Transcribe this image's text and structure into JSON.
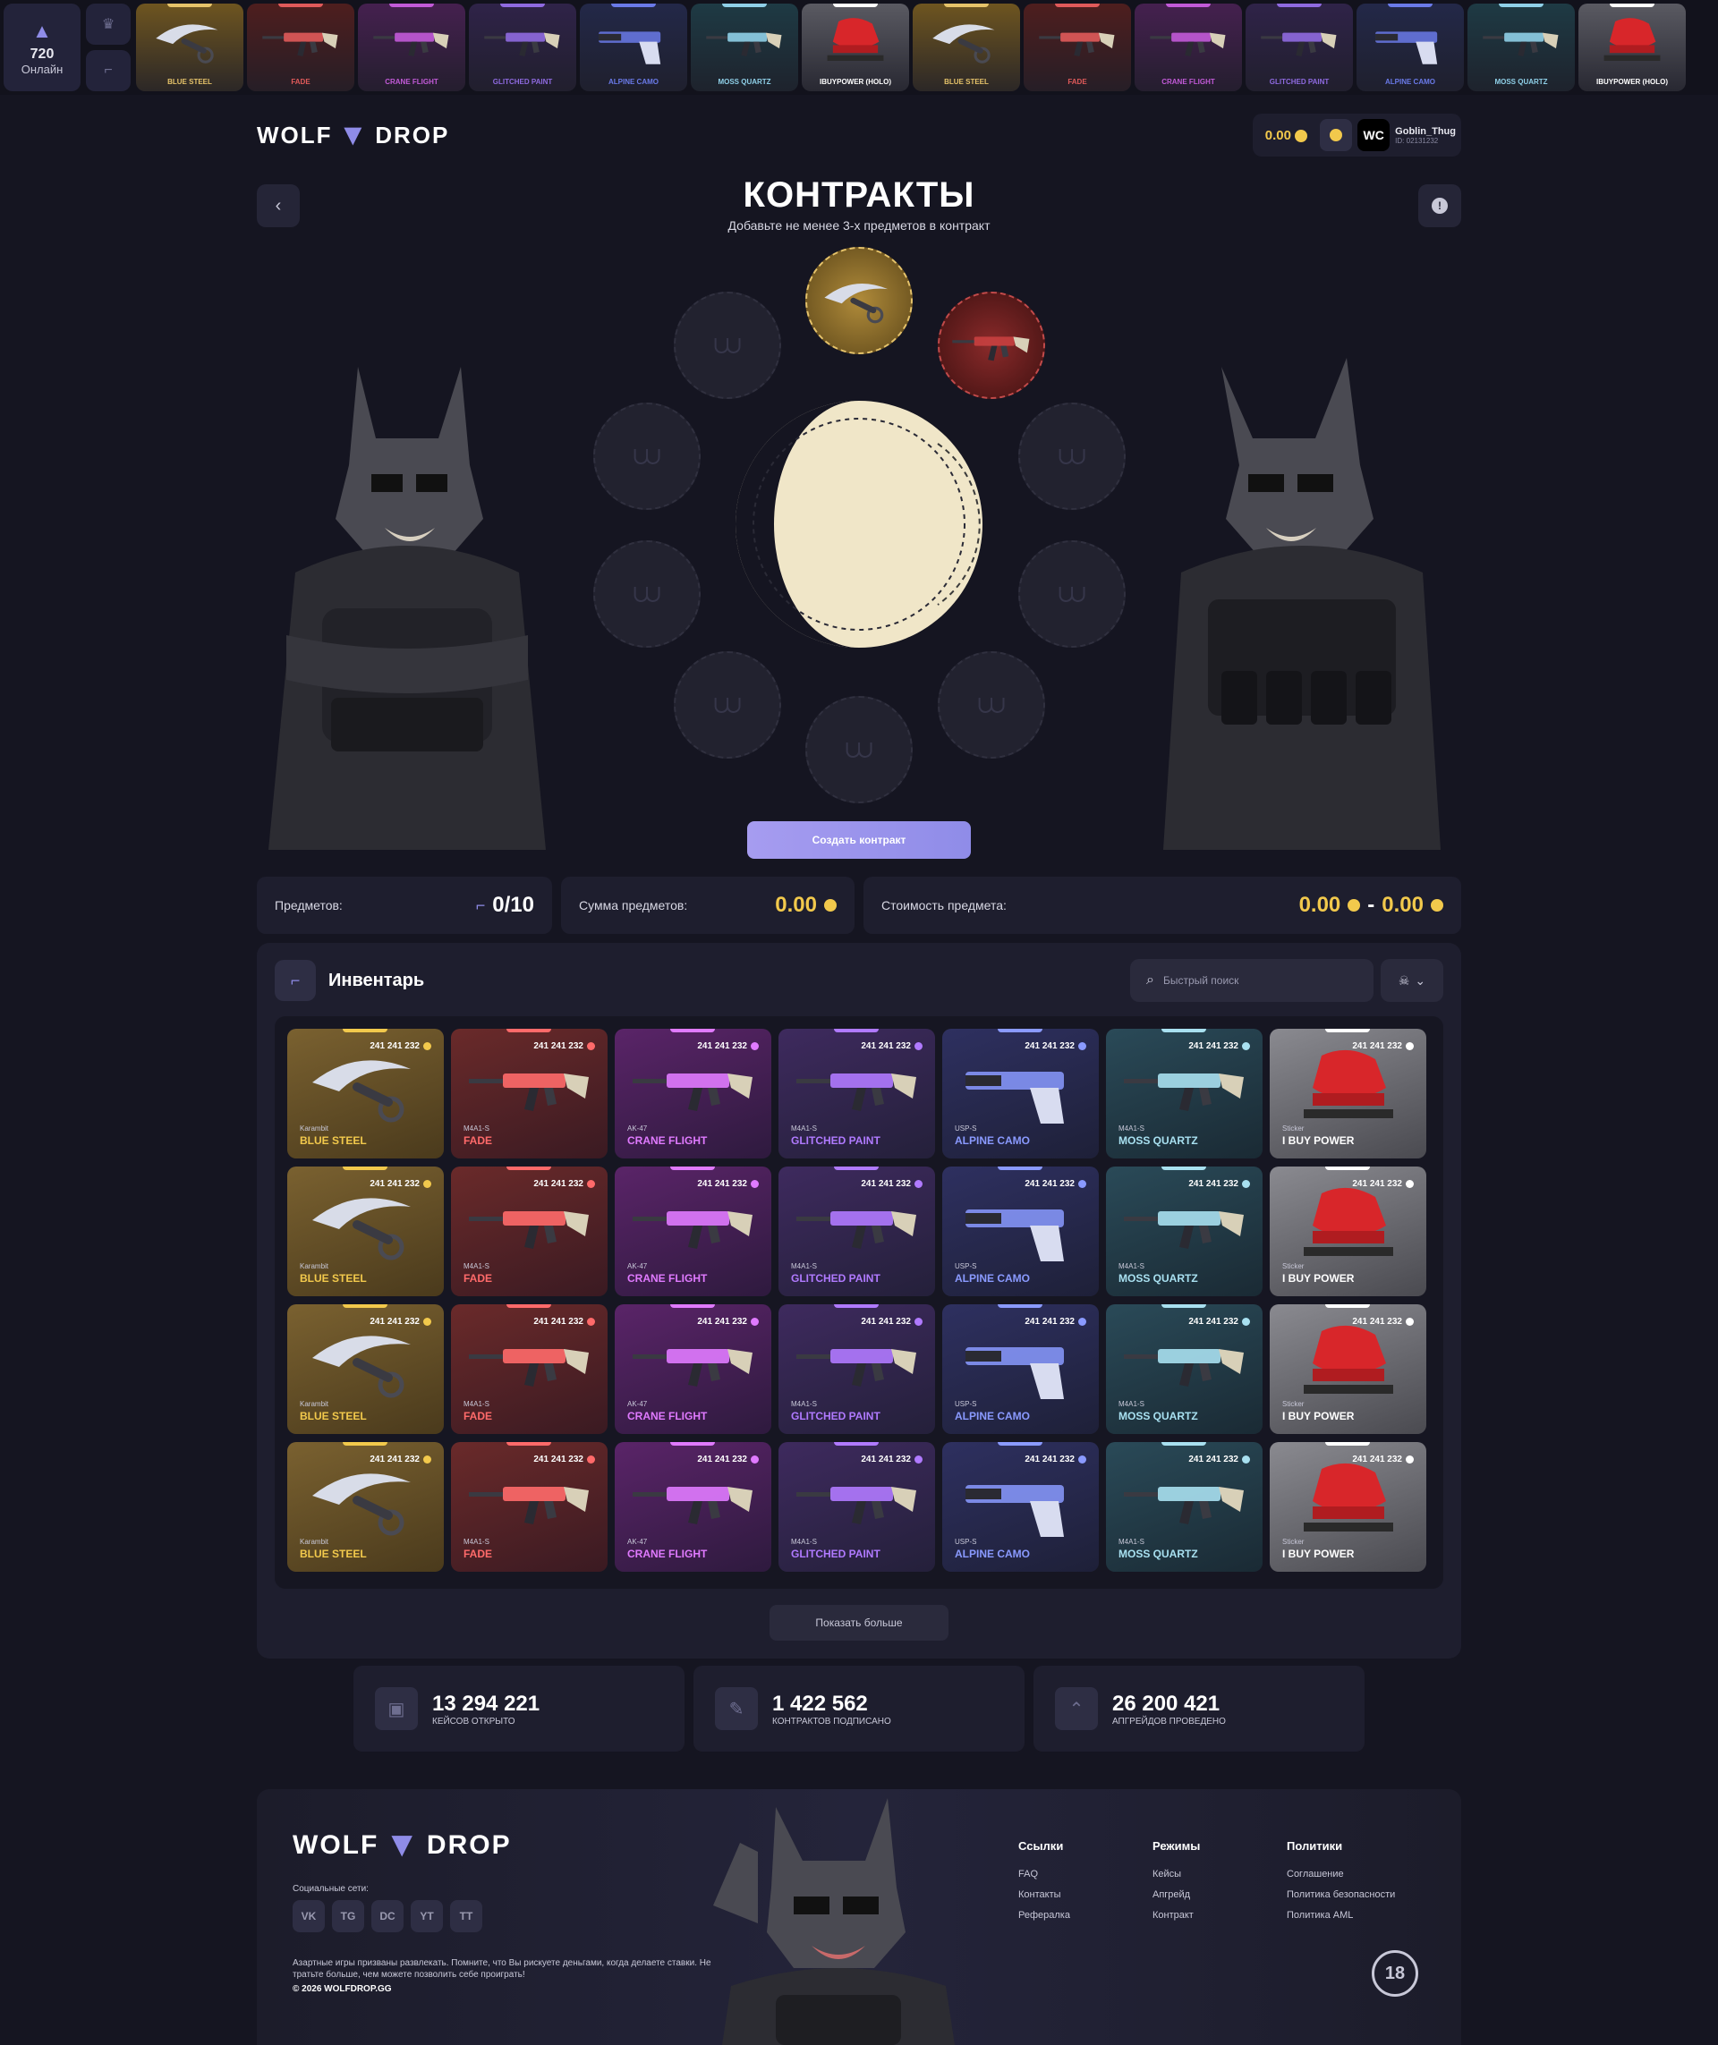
{
  "online": {
    "count": "720",
    "label": "Онлайн"
  },
  "live_drops": [
    {
      "name": "BLUE STEEL",
      "color": "#e6c36a",
      "bg": "#6e5520",
      "kind": "knife"
    },
    {
      "name": "FADE",
      "color": "#e05a5a",
      "bg": "#4e1e1e",
      "kind": "rifle"
    },
    {
      "name": "CRANE FLIGHT",
      "color": "#c25ad8",
      "bg": "#45204f",
      "kind": "rifle"
    },
    {
      "name": "GLITCHED PAINT",
      "color": "#8f6ae0",
      "bg": "#2f2348",
      "kind": "rifle"
    },
    {
      "name": "ALPINE CAMO",
      "color": "#6a7ae8",
      "bg": "#232848",
      "kind": "pistol"
    },
    {
      "name": "MOSS QUARTZ",
      "color": "#8fd0e8",
      "bg": "#1e3a44",
      "kind": "rifle"
    },
    {
      "name": "iBUYPOWER (Holo)",
      "color": "#ffffff",
      "bg": "#5a5a62",
      "kind": "sticker"
    },
    {
      "name": "BLUE STEEL",
      "color": "#e6c36a",
      "bg": "#6e5520",
      "kind": "knife"
    },
    {
      "name": "FADE",
      "color": "#e05a5a",
      "bg": "#4e1e1e",
      "kind": "rifle"
    },
    {
      "name": "CRANE FLIGHT",
      "color": "#c25ad8",
      "bg": "#45204f",
      "kind": "rifle"
    },
    {
      "name": "GLITCHED PAINT",
      "color": "#8f6ae0",
      "bg": "#2f2348",
      "kind": "rifle"
    },
    {
      "name": "ALPINE CAMO",
      "color": "#6a7ae8",
      "bg": "#232848",
      "kind": "pistol"
    },
    {
      "name": "MOSS QUARTZ",
      "color": "#8fd0e8",
      "bg": "#1e3a44",
      "kind": "rifle"
    },
    {
      "name": "iBUYPOWER (Holo)",
      "color": "#ffffff",
      "bg": "#5a5a62",
      "kind": "sticker"
    }
  ],
  "header": {
    "logo_left": "WOLF",
    "logo_right": "DROP",
    "balance": "0.00",
    "avatar_text": "WC",
    "username": "Goblin_Thug",
    "user_id": "ID: 02131232"
  },
  "contract": {
    "title": "КОНТРАКТЫ",
    "subtitle": "Добавьте не менее 3-х предметов в контракт",
    "create_button": "Создать контракт"
  },
  "stats": {
    "items_label": "Предметов:",
    "items_value": "0/10",
    "sum_label": "Сумма предметов:",
    "sum_value": "0.00",
    "price_label": "Стоимость предмета:",
    "price_min": "0.00",
    "price_sep": "-",
    "price_max": "0.00"
  },
  "inventory": {
    "title": "Инвентарь",
    "search_placeholder": "Быстрый поиск",
    "show_more": "Показать больше",
    "price": "241 241 232",
    "row_template": [
      {
        "type": "Karambit",
        "name": "BLUE STEEL",
        "color": "#f2c94c",
        "bg1": "#7a6130",
        "bg2": "#4a3a1c",
        "kind": "knife"
      },
      {
        "type": "M4A1-S",
        "name": "FADE",
        "color": "#ff6a6a",
        "bg1": "#6a2a2a",
        "bg2": "#3a1a22",
        "kind": "rifle"
      },
      {
        "type": "AK-47",
        "name": "CRANE FLIGHT",
        "color": "#e07aff",
        "bg1": "#5a2468",
        "bg2": "#2e1a3e",
        "kind": "rifle"
      },
      {
        "type": "M4A1-S",
        "name": "GLITCHED PAINT",
        "color": "#b07aff",
        "bg1": "#3e2a5e",
        "bg2": "#24203a",
        "kind": "rifle"
      },
      {
        "type": "USP-S",
        "name": "ALPINE CAMO",
        "color": "#8a9aff",
        "bg1": "#2e3060",
        "bg2": "#1e2038",
        "kind": "pistol"
      },
      {
        "type": "M4A1-S",
        "name": "MOSS QUARTZ",
        "color": "#a8e0f0",
        "bg1": "#2a4a58",
        "bg2": "#1a2a34",
        "kind": "rifle"
      },
      {
        "type": "Sticker",
        "name": "I BUY POWER",
        "color": "#ffffff",
        "bg1": "#8a8a90",
        "bg2": "#4a4a50",
        "kind": "sticker"
      }
    ],
    "rows": 4
  },
  "counters": [
    {
      "value": "13 294 221",
      "label": "кейсов открыто",
      "icon": "case-icon"
    },
    {
      "value": "1 422 562",
      "label": "контрактов подписано",
      "icon": "contract-icon"
    },
    {
      "value": "26 200 421",
      "label": "апгрейдов проведено",
      "icon": "upgrade-icon"
    }
  ],
  "footer": {
    "social_label": "Социальные сети:",
    "socials": [
      "VK",
      "TG",
      "DC",
      "YT",
      "TT"
    ],
    "disclaimer": "Азартные игры призваны развлекать. Помните, что Вы рискуете деньгами, когда делаете ставки. Не тратьте больше, чем можете позволить себе проиграть!",
    "copyright": "© 2026 WOLFDROP.GG",
    "columns": [
      {
        "heading": "Ссылки",
        "links": [
          "FAQ",
          "Контакты",
          "Рефералка"
        ]
      },
      {
        "heading": "Режимы",
        "links": [
          "Кейсы",
          "Апгрейд",
          "Контракт"
        ]
      },
      {
        "heading": "Политики",
        "links": [
          "Соглашение",
          "Политика безопасности",
          "Политика AML"
        ]
      }
    ],
    "age": "18"
  }
}
